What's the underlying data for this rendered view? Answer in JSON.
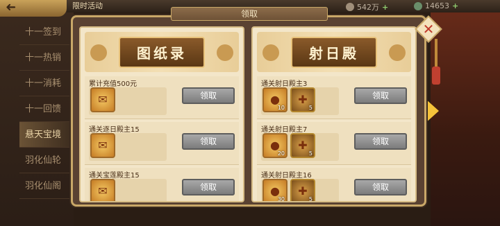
{
  "top": {
    "tab_label": "限时活动",
    "dialog_title": "领取",
    "currency1": "542万",
    "currency2": "14653"
  },
  "sidebar": {
    "items": [
      {
        "label": "十一签到",
        "active": false
      },
      {
        "label": "十一热销",
        "active": false
      },
      {
        "label": "十一消耗",
        "active": false
      },
      {
        "label": "十一回馈",
        "active": false
      },
      {
        "label": "悬天宝境",
        "active": true
      },
      {
        "label": "羽化仙轮",
        "active": false
      },
      {
        "label": "羽化仙阁",
        "active": false
      }
    ]
  },
  "panels": [
    {
      "title": "图纸录",
      "rows": [
        {
          "title": "累计充值500元",
          "items": [
            {
              "count": ""
            }
          ],
          "button": "领取"
        },
        {
          "title": "通关逐日殿主15",
          "items": [
            {
              "count": ""
            }
          ],
          "button": "领取"
        },
        {
          "title": "通关宝莲殿主15",
          "items": [
            {
              "count": ""
            }
          ],
          "button": "领取"
        }
      ]
    },
    {
      "title": "射日殿",
      "rows": [
        {
          "title": "通关射日殿主3",
          "items": [
            {
              "count": "10"
            },
            {
              "count": "5"
            }
          ],
          "button": "领取"
        },
        {
          "title": "通关射日殿主7",
          "items": [
            {
              "count": "20"
            },
            {
              "count": "5"
            }
          ],
          "button": "领取"
        },
        {
          "title": "通关射日殿主16",
          "items": [
            {
              "count": "30"
            },
            {
              "count": "5"
            }
          ],
          "button": "领取"
        }
      ]
    }
  ],
  "icons": {
    "close": "close-icon",
    "next": "chevron-right-icon",
    "back": "back-arrow-icon"
  }
}
